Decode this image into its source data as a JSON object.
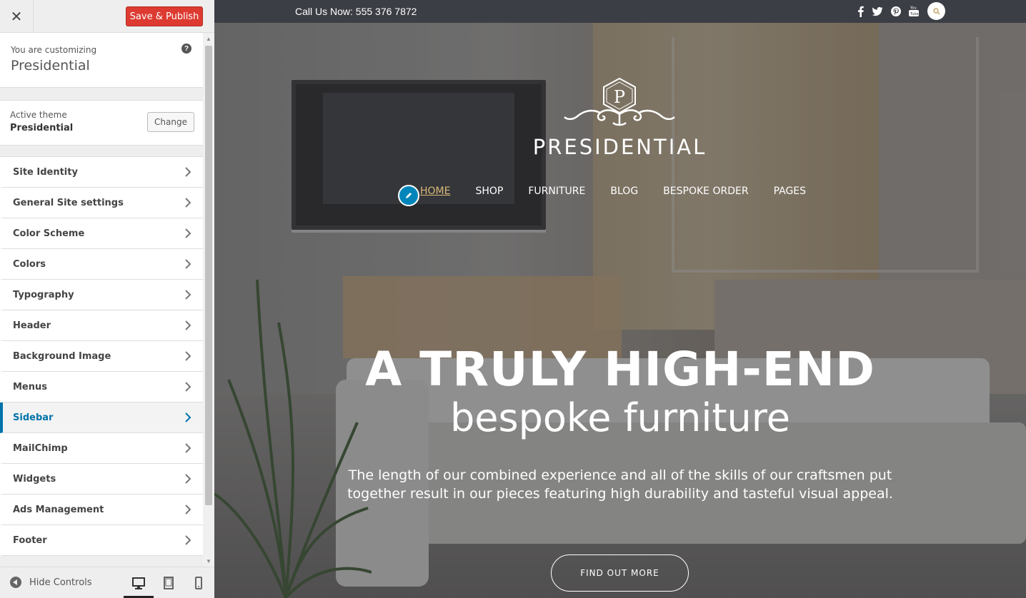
{
  "customizer": {
    "close_label": "✕",
    "save_label": "Save & Publish",
    "customizing_label": "You are customizing",
    "site_name": "Presidential",
    "help_label": "?",
    "active_theme_label": "Active theme",
    "active_theme_name": "Presidential",
    "change_label": "Change",
    "sections": [
      {
        "label": "Site Identity",
        "active": false
      },
      {
        "label": "General Site settings",
        "active": false
      },
      {
        "label": "Color Scheme",
        "active": false
      },
      {
        "label": "Colors",
        "active": false
      },
      {
        "label": "Typography",
        "active": false
      },
      {
        "label": "Header",
        "active": false
      },
      {
        "label": "Background Image",
        "active": false
      },
      {
        "label": "Menus",
        "active": false
      },
      {
        "label": "Sidebar",
        "active": true
      },
      {
        "label": "MailChimp",
        "active": false
      },
      {
        "label": "Widgets",
        "active": false
      },
      {
        "label": "Ads Management",
        "active": false
      },
      {
        "label": "Footer",
        "active": false
      }
    ],
    "hide_controls_label": "Hide Controls",
    "devices": [
      "desktop-icon",
      "tablet-icon",
      "mobile-icon"
    ],
    "active_device": "desktop"
  },
  "preview": {
    "call_us": "Call Us Now: 555 376 7872",
    "social_icons": [
      "facebook-icon",
      "twitter-icon",
      "pinterest-icon",
      "youtube-icon"
    ],
    "brand_name": "PRESIDENTIAL",
    "logo_letter": "P",
    "nav": [
      {
        "label": "HOME",
        "current": true
      },
      {
        "label": "SHOP",
        "current": false
      },
      {
        "label": "FURNITURE",
        "current": false
      },
      {
        "label": "BLOG",
        "current": false
      },
      {
        "label": "BESPOKE ORDER",
        "current": false
      },
      {
        "label": "PAGES",
        "current": false
      }
    ],
    "headline": "A TRULY HIGH-END",
    "subheadline": "bespoke furniture",
    "description": "The length of our combined experience and all of the skills of our craftsmen put together result in our pieces featuring high durability and tasteful visual appeal.",
    "cta_label": "FIND OUT MORE"
  },
  "colors": {
    "save_button": "#dd3b31",
    "active_section": "#0073aa",
    "nav_current": "#d9b87a",
    "topbar": "#3c3e45",
    "edit_shortcut": "#0085ba"
  }
}
